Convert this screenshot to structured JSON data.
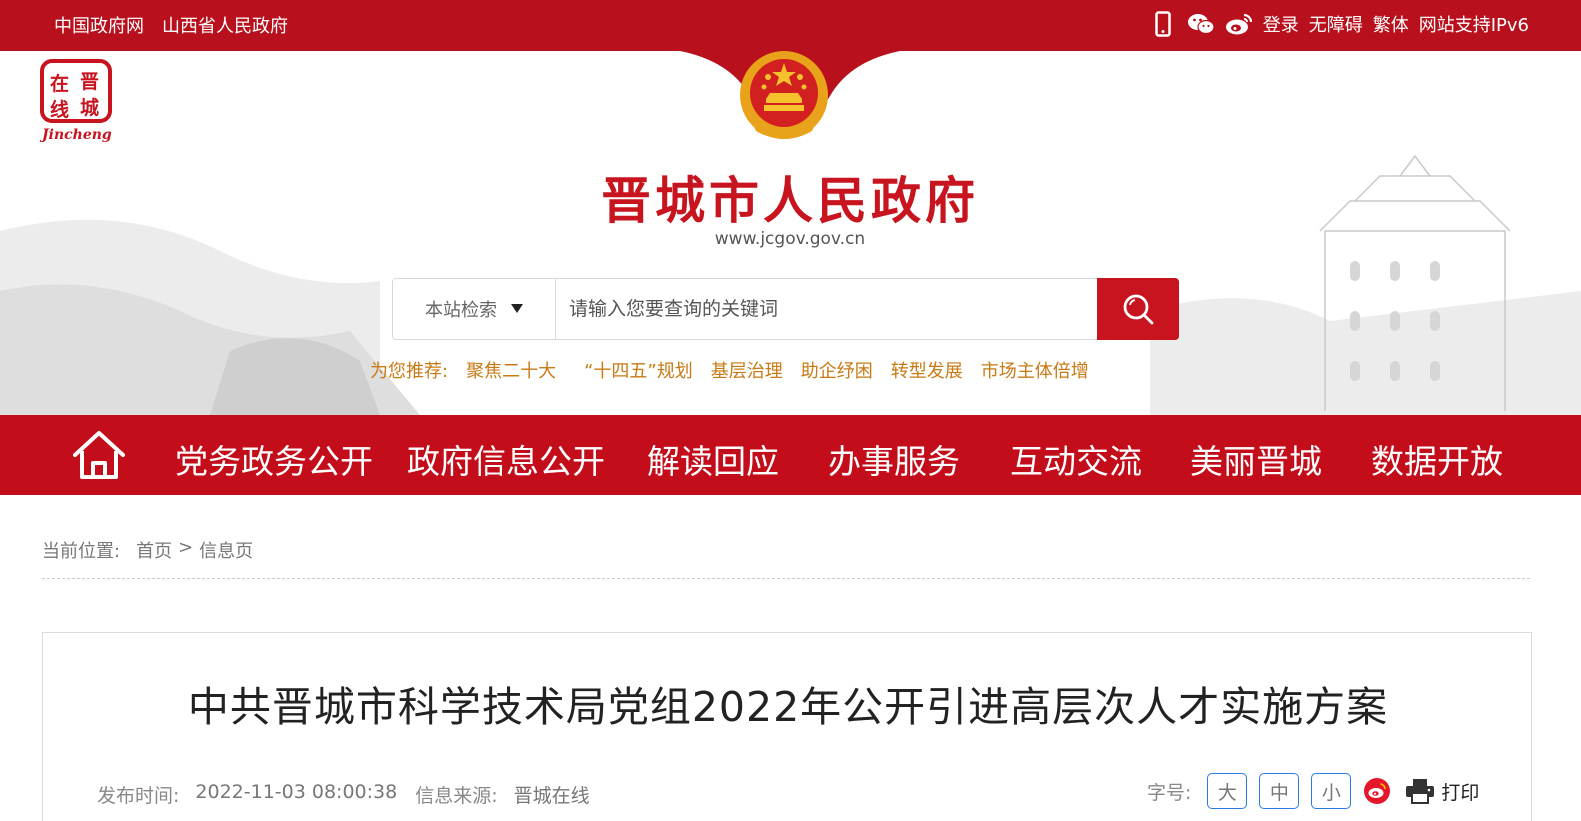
{
  "topbar": {
    "links": [
      "中国政府网",
      "山西省人民政府"
    ],
    "right_links": [
      "登录",
      "无障碍",
      "繁体",
      "网站支持IPv6"
    ],
    "icons": [
      "mobile-icon",
      "wechat-icon",
      "weibo-icon"
    ]
  },
  "header": {
    "logo_chars": [
      "在",
      "晋",
      "线",
      "城"
    ],
    "logo_en": "Jincheng",
    "site_title": "晋城市人民政府",
    "site_url": "www.jcgov.gov.cn"
  },
  "search": {
    "scope_label": "本站检索",
    "placeholder": "请输入您要查询的关键词"
  },
  "recommend": {
    "label": "为您推荐:",
    "items": [
      "聚焦二十大",
      "“十四五”规划",
      "基层治理",
      "助企纾困",
      "转型发展",
      "市场主体倍增"
    ]
  },
  "nav": {
    "items": [
      "党务政务公开",
      "政府信息公开",
      "解读回应",
      "办事服务",
      "互动交流",
      "美丽晋城",
      "数据开放"
    ]
  },
  "breadcrumb": {
    "label": "当前位置:",
    "home": "首页",
    "separator": ">",
    "current": "信息页"
  },
  "article": {
    "title": "中共晋城市科学技术局党组2022年公开引进高层次人才实施方案",
    "publish_label": "发布时间:",
    "publish_time": "2022-11-03 08:00:38",
    "source_label": "信息来源:",
    "source": "晋城在线",
    "fontsize_label": "字号:",
    "fontsize_options": [
      "大",
      "中",
      "小"
    ],
    "print_label": "打印"
  },
  "colors": {
    "brand_red": "#c30d1a",
    "accent_orange": "#c87a14",
    "fontsize_border": "#2c7be5"
  }
}
